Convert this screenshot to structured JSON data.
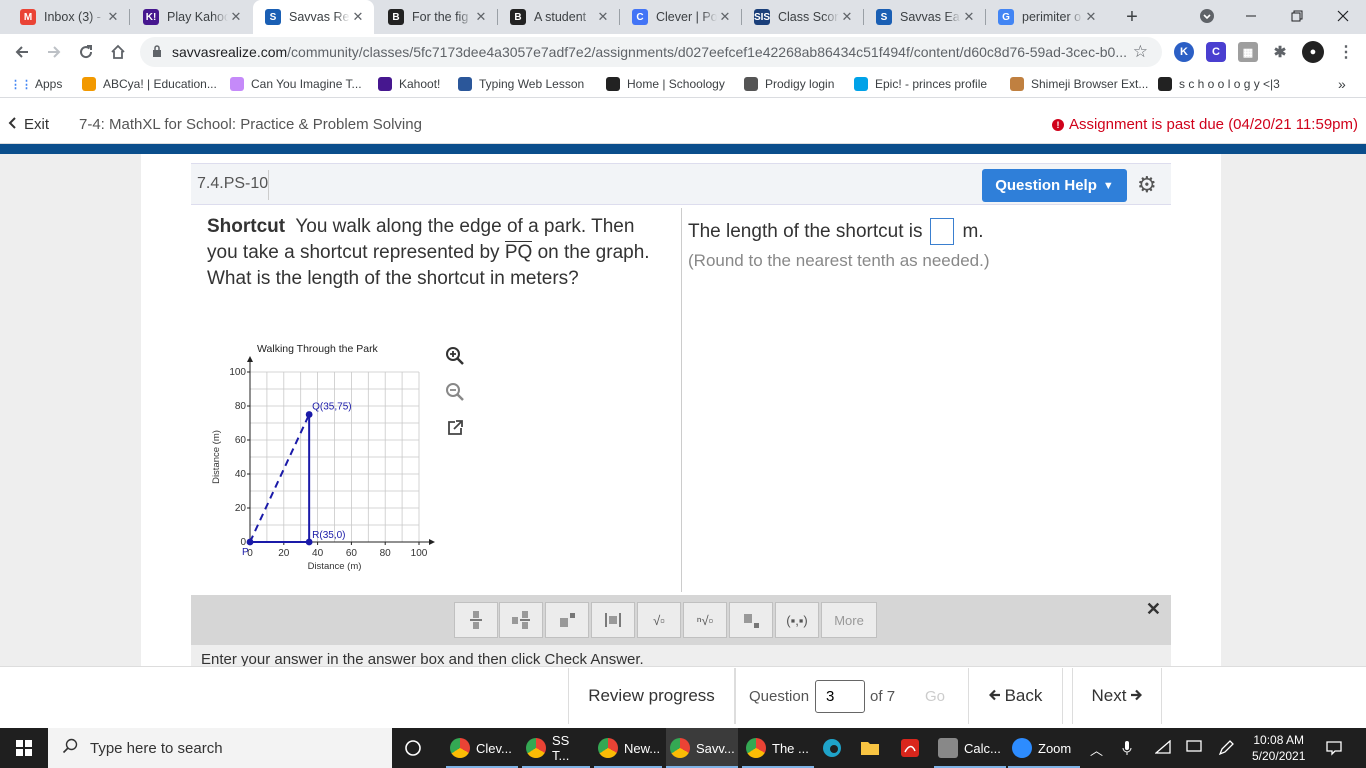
{
  "browser": {
    "tabs": [
      {
        "label": "Inbox (3) -",
        "icon_text": "M",
        "icon_color": "#ea4335",
        "active": false
      },
      {
        "label": "Play Kahoo",
        "icon_text": "K!",
        "icon_color": "#46178f",
        "active": false
      },
      {
        "label": "Savvas Rea",
        "icon_text": "S",
        "icon_color": "#1a5fb4",
        "active": true
      },
      {
        "label": "For the fig",
        "icon_text": "B",
        "icon_color": "#222",
        "active": false
      },
      {
        "label": "A student",
        "icon_text": "B",
        "icon_color": "#222",
        "active": false
      },
      {
        "label": "Clever | Po",
        "icon_text": "C",
        "icon_color": "#4274f6",
        "active": false
      },
      {
        "label": "Class Score",
        "icon_text": "SIS",
        "icon_color": "#1a3f7a",
        "active": false
      },
      {
        "label": "Savvas Eas",
        "icon_text": "S",
        "icon_color": "#1a5fb4",
        "active": false
      },
      {
        "label": "perimiter o",
        "icon_text": "G",
        "icon_color": "#4285f4",
        "active": false
      }
    ],
    "new_tab": "+",
    "url_host": "savvasrealize.com",
    "url_path": "/community/classes/5fc7173dee4a3057e7adf7e2/assignments/d027eefcef1e42268ab86434c51f494f/content/d60c8d76-59ad-3cec-b0...",
    "bookmarks": [
      {
        "label": "Apps",
        "icon_color": "#4285f4"
      },
      {
        "label": "ABCya! | Education...",
        "icon_color": "#f29900"
      },
      {
        "label": "Can You Imagine T...",
        "icon_color": "#c58af9"
      },
      {
        "label": "Kahoot!",
        "icon_color": "#46178f"
      },
      {
        "label": "Typing Web Lesson",
        "icon_color": "#2b579a"
      },
      {
        "label": "Home | Schoology",
        "icon_color": "#222"
      },
      {
        "label": "Prodigy login",
        "icon_color": "#555"
      },
      {
        "label": "Epic! - princes profile",
        "icon_color": "#00a2e8"
      },
      {
        "label": "Shimeji Browser Ext...",
        "icon_color": "#c08040"
      },
      {
        "label": "s c h o o l o g y <|3",
        "icon_color": "#222"
      }
    ],
    "bookmarks_more": "»"
  },
  "app": {
    "exit_label": "Exit",
    "title": "7-4: MathXL for School: Practice & Problem Solving",
    "past_due": "Assignment is past due (04/20/21 11:59pm)",
    "past_due_color": "#d0021b"
  },
  "question": {
    "id": "7.4.PS-10",
    "help_label": "Question Help",
    "title_bold": "Shortcut",
    "text_1": "You walk along the edge of a park. Then you take a shortcut represented by",
    "segment": "PQ",
    "text_2": "on the graph. What is the length of the shortcut in meters?",
    "answer_prefix": "The length of the shortcut is",
    "answer_suffix": "m.",
    "hint": "(Round to the nearest tenth as needed.)"
  },
  "chart_data": {
    "type": "line",
    "title": "Walking Through the Park",
    "xlabel": "Distance (m)",
    "ylabel": "Distance (m)",
    "xlim": [
      0,
      100
    ],
    "ylim": [
      0,
      100
    ],
    "x_ticks": [
      0,
      20,
      40,
      60,
      80,
      100
    ],
    "y_ticks": [
      0,
      20,
      40,
      60,
      80,
      100
    ],
    "grid_step": 10,
    "points": [
      {
        "name": "P",
        "label": "P",
        "x": 0,
        "y": 0
      },
      {
        "name": "Q",
        "label": "Q(35,75)",
        "x": 35,
        "y": 75
      },
      {
        "name": "R",
        "label": "R(35,0)",
        "x": 35,
        "y": 0
      }
    ],
    "segments": [
      {
        "from": "P",
        "to": "R",
        "style": "solid"
      },
      {
        "from": "R",
        "to": "Q",
        "style": "solid"
      },
      {
        "from": "P",
        "to": "Q",
        "style": "dashed"
      }
    ],
    "color": "#1a1aa8"
  },
  "math_toolbar": {
    "buttons": [
      "fraction",
      "mixed-number",
      "exponent",
      "absolute-value",
      "square-root",
      "nth-root",
      "subscript",
      "ordered-pair"
    ],
    "more_label": "More",
    "instructions": "Enter your answer in the answer box and then click Check Answer."
  },
  "bottom_nav": {
    "review": "Review progress",
    "question_label": "Question",
    "question_value": "3",
    "of_label": "of 7",
    "go": "Go",
    "back": "Back",
    "next": "Next"
  },
  "taskbar": {
    "search_placeholder": "Type here to search",
    "apps": [
      {
        "label": "Clev...",
        "color": "#4caf50"
      },
      {
        "label": "SS T...",
        "color": "#4caf50"
      },
      {
        "label": "New...",
        "color": "#4caf50"
      },
      {
        "label": "Savv...",
        "color": "#4caf50"
      },
      {
        "label": "The ...",
        "color": "#4caf50"
      },
      {
        "label": "Calc...",
        "color": "#888"
      },
      {
        "label": "Zoom",
        "color": "#2d8cff"
      }
    ],
    "time": "10:08 AM",
    "date": "5/20/2021"
  }
}
